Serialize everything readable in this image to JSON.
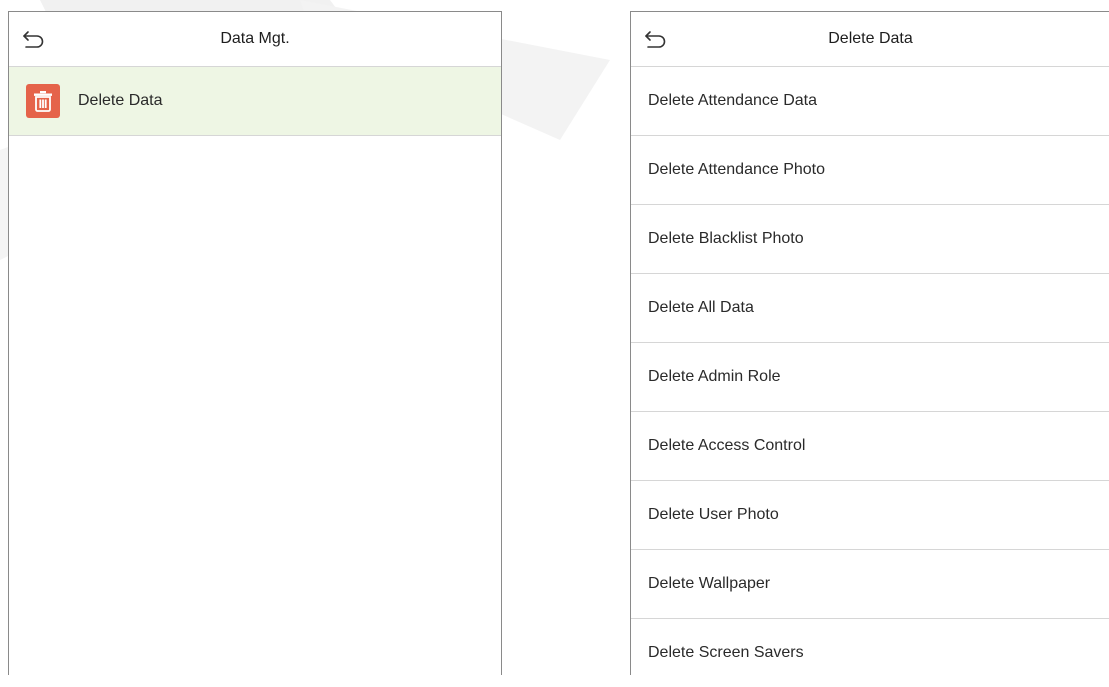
{
  "colors": {
    "selected_row_bg": "#eef6e4",
    "trash_icon_bg": "#e5634a",
    "divider": "#d6d6d6",
    "frame": "#8a8a8a"
  },
  "left_screen": {
    "title": "Data Mgt.",
    "back_icon": "return-arrow-icon",
    "items": [
      {
        "label": "Delete Data",
        "icon": "trash-icon",
        "selected": true
      }
    ]
  },
  "right_screen": {
    "title": "Delete Data",
    "back_icon": "return-arrow-icon",
    "items": [
      {
        "label": "Delete Attendance Data"
      },
      {
        "label": "Delete Attendance Photo"
      },
      {
        "label": "Delete Blacklist Photo"
      },
      {
        "label": "Delete All Data"
      },
      {
        "label": "Delete Admin Role"
      },
      {
        "label": "Delete Access Control"
      },
      {
        "label": "Delete User Photo"
      },
      {
        "label": "Delete Wallpaper"
      },
      {
        "label": "Delete Screen Savers"
      }
    ]
  }
}
